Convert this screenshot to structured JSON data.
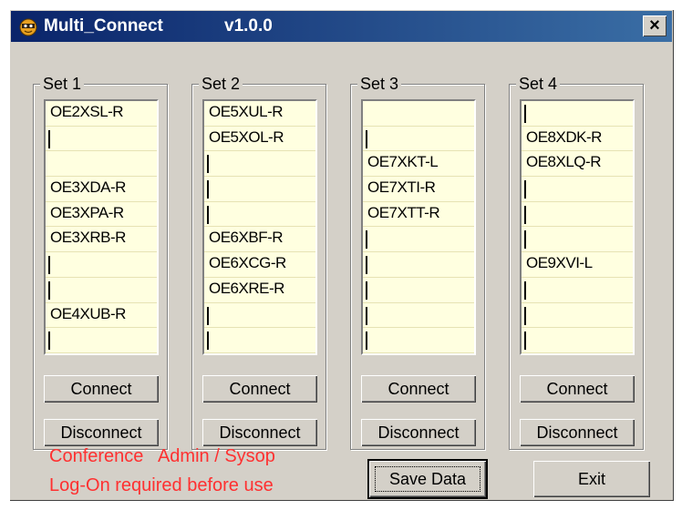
{
  "window": {
    "title": "Multi_Connect",
    "version": "v1.0.0",
    "close_label": "×"
  },
  "sets": [
    {
      "label": "Set 1",
      "entries": [
        "OE2XSL-R",
        "",
        "",
        "OE3XDA-R",
        "OE3XPA-R",
        "OE3XRB-R",
        "",
        "",
        "OE4XUB-R",
        ""
      ]
    },
    {
      "label": "Set 2",
      "entries": [
        "OE5XUL-R",
        "OE5XOL-R",
        "",
        "",
        "",
        "OE6XBF-R",
        "OE6XCG-R",
        "OE6XRE-R",
        "",
        ""
      ]
    },
    {
      "label": "Set 3",
      "entries": [
        "",
        "",
        "OE7XKT-L",
        "OE7XTI-R",
        "OE7XTT-R",
        "",
        "",
        "",
        "",
        ""
      ]
    },
    {
      "label": "Set 4",
      "entries": [
        "",
        "OE8XDK-R",
        "OE8XLQ-R",
        "",
        "",
        "",
        "OE9XVI-L",
        "",
        "",
        ""
      ]
    }
  ],
  "buttons": {
    "connect": "Connect",
    "disconnect": "Disconnect",
    "save": "Save Data",
    "exit": "Exit"
  },
  "notice": {
    "line1": "Conference   Admin / Sysop",
    "line2": "Log-On required before use"
  },
  "colors": {
    "notice_text": "#ff3030",
    "list_background": "#ffffe0",
    "titlebar": "#0a246a"
  }
}
